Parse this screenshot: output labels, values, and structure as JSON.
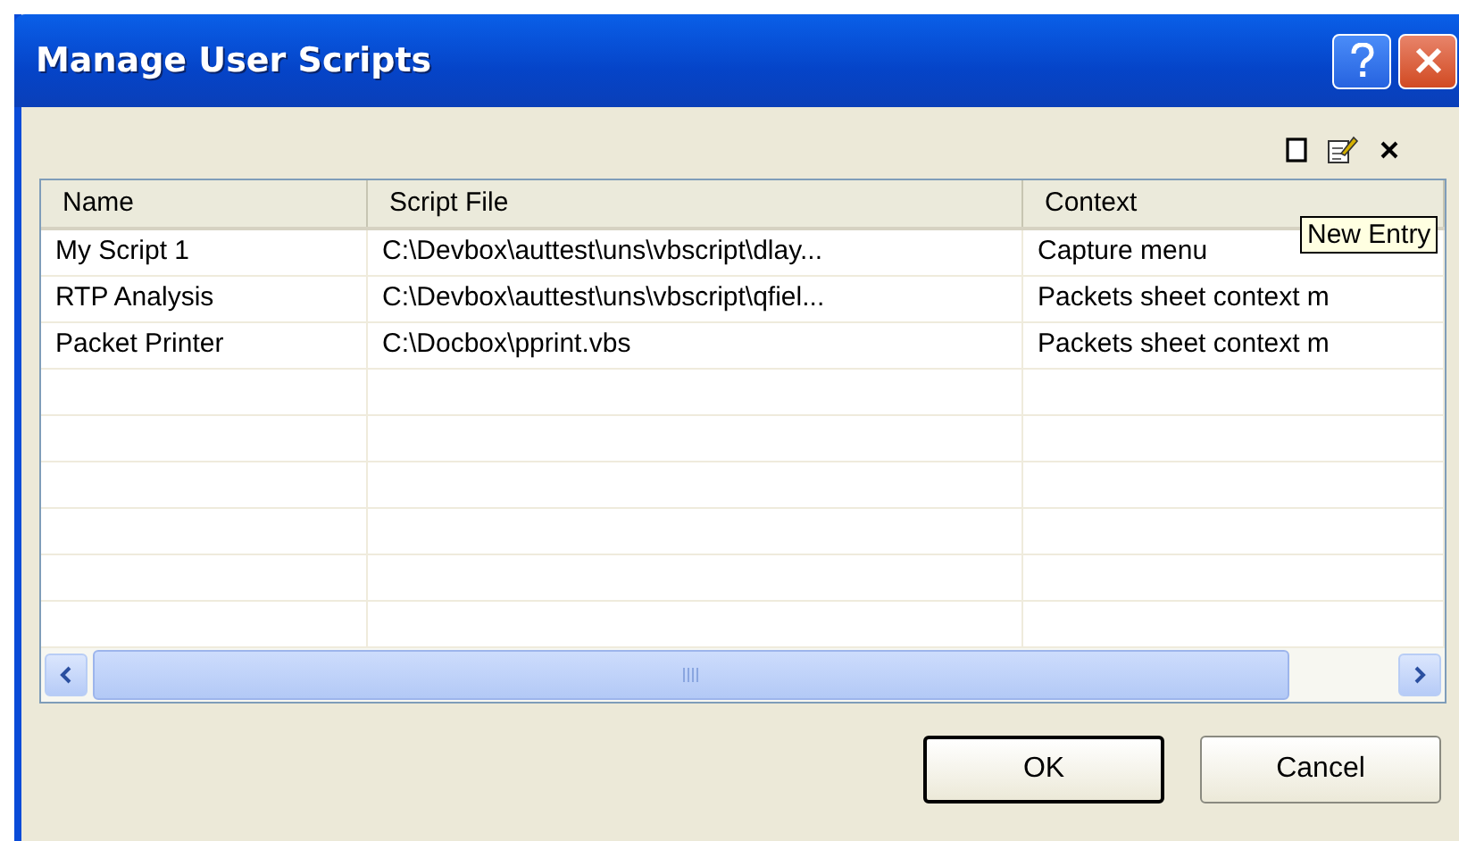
{
  "window": {
    "title": "Manage User Scripts"
  },
  "tooltip": "New Entry",
  "table": {
    "columns": [
      "Name",
      "Script File",
      "Context"
    ],
    "rows": [
      {
        "cells": [
          "My Script 1",
          "C:\\Devbox\\auttest\\uns\\vbscript\\dlay...",
          "Capture menu"
        ]
      },
      {
        "cells": [
          "RTP Analysis",
          "C:\\Devbox\\auttest\\uns\\vbscript\\qfiel...",
          "Packets sheet context m"
        ]
      },
      {
        "cells": [
          "Packet Printer",
          "C:\\Docbox\\pprint.vbs",
          "Packets sheet context m"
        ]
      }
    ]
  },
  "buttons": [
    {
      "label": "OK",
      "default": true
    },
    {
      "label": "Cancel",
      "default": false
    }
  ]
}
